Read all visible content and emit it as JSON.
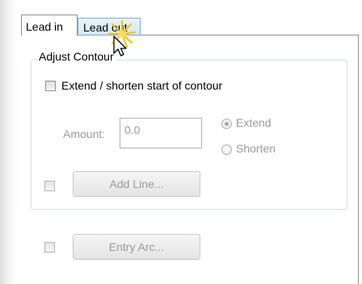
{
  "tabs": [
    {
      "label": "Lead in",
      "selected": true
    },
    {
      "label": "Lead out",
      "selected": false
    }
  ],
  "group": {
    "title": "Adjust Contour",
    "extend_checkbox_label": "Extend / shorten start of contour",
    "amount_label": "Amount:",
    "amount_value": "0.0",
    "radio_extend_label": "Extend",
    "radio_shorten_label": "Shorten",
    "add_line_button": "Add Line..."
  },
  "entry_arc_button": "Entry Arc...",
  "colors": {
    "tab_hover": "#d3e8f8",
    "disabled_text": "#9a9a9a",
    "highlight_burst": "#f5c400"
  },
  "icons": {
    "cursor": "arrow-cursor-icon",
    "burst": "click-highlight-icon"
  }
}
